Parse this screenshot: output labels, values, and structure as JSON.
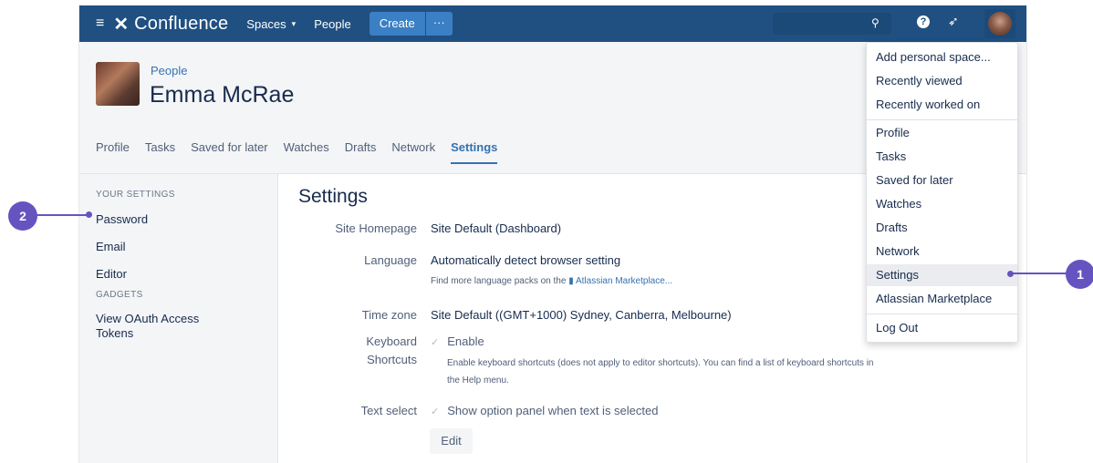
{
  "colors": {
    "nav_bg": "#205081",
    "accent": "#3572b0",
    "create_bg": "#3b7fc4",
    "callout": "#6554c0",
    "panel_bg": "#f4f5f7"
  },
  "topnav": {
    "menu_icon": "hamburger-icon",
    "logo_icon": "confluence-logo-icon",
    "logo_text": "Confluence",
    "spaces_label": "Spaces",
    "people_label": "People",
    "create_label": "Create",
    "more_label": "···",
    "search_icon": "search-icon",
    "help_icon": "help-icon",
    "notifications_icon": "notifications-icon",
    "avatar_icon": "user-avatar"
  },
  "profile": {
    "breadcrumb": "People",
    "name": "Emma McRae",
    "tabs": [
      {
        "label": "Profile"
      },
      {
        "label": "Tasks"
      },
      {
        "label": "Saved for later"
      },
      {
        "label": "Watches"
      },
      {
        "label": "Drafts"
      },
      {
        "label": "Network"
      },
      {
        "label": "Settings",
        "active": true
      }
    ]
  },
  "sidebar": {
    "your_settings_heading": "YOUR SETTINGS",
    "items": [
      {
        "label": "Password"
      },
      {
        "label": "Email"
      },
      {
        "label": "Editor"
      }
    ],
    "gadgets_heading": "GADGETS",
    "gadget_items": [
      {
        "label": "View OAuth Access Tokens"
      }
    ]
  },
  "main": {
    "title": "Settings",
    "site_homepage_label": "Site Homepage",
    "site_homepage_value": "Site Default (Dashboard)",
    "language_label": "Language",
    "language_value": "Automatically detect browser setting",
    "language_hint": "Find more language packs on the",
    "marketplace_link": "Atlassian Marketplace...",
    "timezone_label": "Time zone",
    "timezone_value": "Site Default ((GMT+1000) Sydney, Canberra, Melbourne)",
    "shortcuts_label_1": "Keyboard",
    "shortcuts_label_2": "Shortcuts",
    "shortcuts_value": "Enable",
    "shortcuts_hint_1": "Enable keyboard shortcuts (does not apply to editor shortcuts). You can find a list of keyboard shortcuts in",
    "shortcuts_hint_2": "the Help menu.",
    "text_select_label": "Text select",
    "text_select_value": "Show option panel when text is selected",
    "edit_label": "Edit"
  },
  "dropdown": {
    "group1": [
      {
        "label": "Add personal space..."
      },
      {
        "label": "Recently viewed"
      },
      {
        "label": "Recently worked on"
      }
    ],
    "group2": [
      {
        "label": "Profile"
      },
      {
        "label": "Tasks"
      },
      {
        "label": "Saved for later"
      },
      {
        "label": "Watches"
      },
      {
        "label": "Drafts"
      },
      {
        "label": "Network"
      },
      {
        "label": "Settings",
        "highlighted": true
      },
      {
        "label": "Atlassian Marketplace"
      }
    ],
    "group3": [
      {
        "label": "Log Out"
      }
    ]
  },
  "callouts": [
    {
      "number": "1"
    },
    {
      "number": "2"
    }
  ]
}
